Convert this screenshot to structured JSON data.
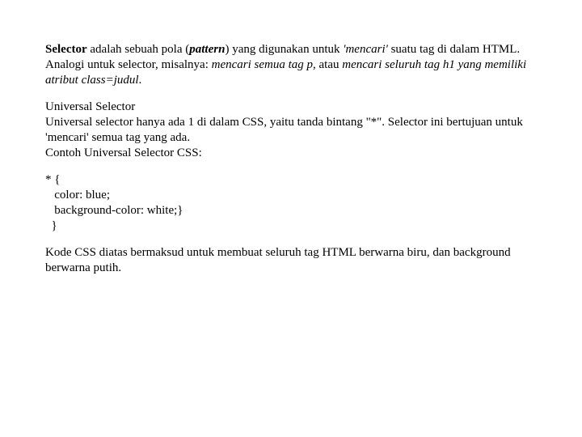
{
  "para1": {
    "t1": "Selector",
    "t2": " adalah sebuah pola (",
    "t3": "pattern",
    "t4": ") yang digunakan untuk ",
    "t5": "'mencari'",
    "t6": " suatu tag di dalam HTML. Analogi untuk selector, misalnya: ",
    "t7": "mencari semua tag p",
    "t8": ", atau ",
    "t9": "mencari seluruh tag h1 yang memiliki atribut class=judul",
    "t10": "."
  },
  "para2": {
    "t1": "Universal Selector",
    "t2": "Universal selector hanya ada 1 di dalam CSS, yaitu tanda bintang \"*\". Selector ini bertujuan untuk 'mencari' semua tag yang ada.",
    "t3": "Contoh Universal Selector CSS:"
  },
  "code": {
    "l1": "* {",
    "l2": "   color: blue;",
    "l3": "   background-color: white;}",
    "l4": "  }"
  },
  "para3": {
    "t1": "Kode CSS diatas bermaksud untuk membuat seluruh tag HTML berwarna biru, dan background berwarna putih."
  }
}
